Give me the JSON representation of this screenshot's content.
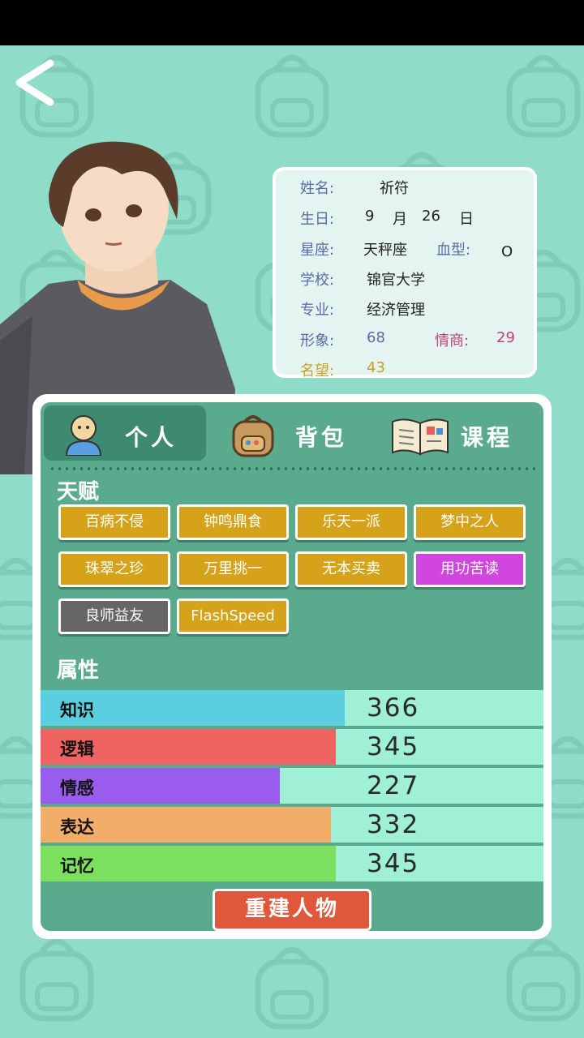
{
  "profile": {
    "name_label": "姓名:",
    "name": "祈符",
    "birthday_label": "生日:",
    "birth_month": "9",
    "month_unit": "月",
    "birth_day": "26",
    "day_unit": "日",
    "zodiac_label": "星座:",
    "zodiac": "天秤座",
    "blood_label": "血型:",
    "blood": "O",
    "school_label": "学校:",
    "school": "锦官大学",
    "major_label": "专业:",
    "major": "经济管理",
    "image_label": "形象:",
    "image_value": "68",
    "eq_label": "情商:",
    "eq_value": "29",
    "fame_label": "名望:",
    "fame_value": "43"
  },
  "tabs": [
    {
      "label": "个人",
      "active": true
    },
    {
      "label": "背包",
      "active": false
    },
    {
      "label": "课程",
      "active": false
    }
  ],
  "talents_title": "天赋",
  "talents": [
    {
      "label": "百病不侵",
      "color": "#d5a21a"
    },
    {
      "label": "钟鸣鼎食",
      "color": "#d5a21a"
    },
    {
      "label": "乐天一派",
      "color": "#d5a21a"
    },
    {
      "label": "梦中之人",
      "color": "#d5a21a"
    },
    {
      "label": "珠翠之珍",
      "color": "#d5a21a"
    },
    {
      "label": "万里挑一",
      "color": "#d5a21a"
    },
    {
      "label": "无本买卖",
      "color": "#d5a21a"
    },
    {
      "label": "用功苦读",
      "color": "#d146df"
    },
    {
      "label": "良师益友",
      "color": "#666666"
    },
    {
      "label": "FlashSpeed",
      "color": "#d5a21a"
    }
  ],
  "attributes_title": "属性",
  "attributes": [
    {
      "name": "知识",
      "value": "366",
      "fill_fraction": 0.605,
      "color": "#5acfe0"
    },
    {
      "name": "逻辑",
      "value": "345",
      "fill_fraction": 0.587,
      "color": "#f06363"
    },
    {
      "name": "情感",
      "value": "227",
      "fill_fraction": 0.476,
      "color": "#9a5bef"
    },
    {
      "name": "表达",
      "value": "332",
      "fill_fraction": 0.577,
      "color": "#f2ad68"
    },
    {
      "name": "记忆",
      "value": "345",
      "fill_fraction": 0.587,
      "color": "#7be05e"
    }
  ],
  "rebuild_button": "重建人物",
  "colors": {
    "background": "#8fdcc8",
    "panel": "#5aab8e",
    "tab_active": "#3d8a70",
    "card": "#e4f5f1",
    "label_blue": "#5a6aa8",
    "image_color": "#5a6aa8",
    "eq_color": "#c0407a",
    "fame_color": "#c9a024"
  }
}
